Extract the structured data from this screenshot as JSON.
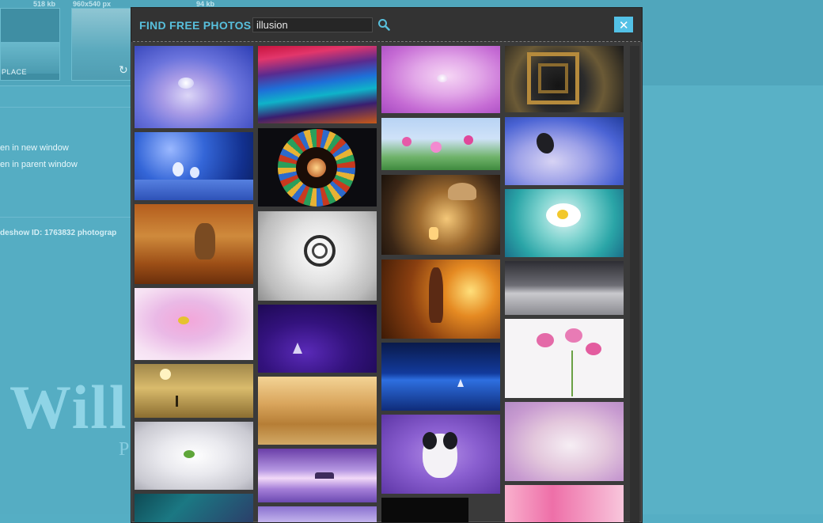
{
  "background": {
    "thumbs": [
      {
        "size": "518 kb",
        "dims": "960x540 px"
      },
      {
        "size": "94 kb"
      }
    ],
    "place_label": "PLACE",
    "links": [
      "en in new window",
      "en in parent window"
    ],
    "slideshow_info": "deshow ID: 1763832 photograp",
    "big_text": "Will",
    "small_text": "P"
  },
  "modal": {
    "title": "FIND FREE PHOTOS",
    "search_value": "illusion",
    "close_label": "✕",
    "accent": "#58c0dd",
    "close_color": "#53c1e6"
  },
  "photos": {
    "columns": 4,
    "count": 26,
    "subjects": [
      "blue-petal-water-drop",
      "colorful-waves",
      "pink-petal-drop",
      "spiral-staircase-gold",
      "blue-flowers-bokeh",
      "stained-glass-spiral",
      "pink-wildflowers",
      "butterfly-on-petal",
      "autumn-cat-field",
      "white-spiral-staircase",
      "girl-reading-lantern",
      "white-daisy-teal",
      "pink-cosmos-flower",
      "purple-night-sailboat",
      "girl-swing-sunset",
      "tree-silhouette-lake",
      "heron-golden-lake",
      "golden-dunes",
      "blue-starry-lake-boat",
      "pink-cosmos-white",
      "white-poppy",
      "purple-lake-island",
      "border-collie-purple",
      "fantasy-angel",
      "green-blue-fantasy",
      "dark-photo",
      "pink-tulips"
    ]
  }
}
